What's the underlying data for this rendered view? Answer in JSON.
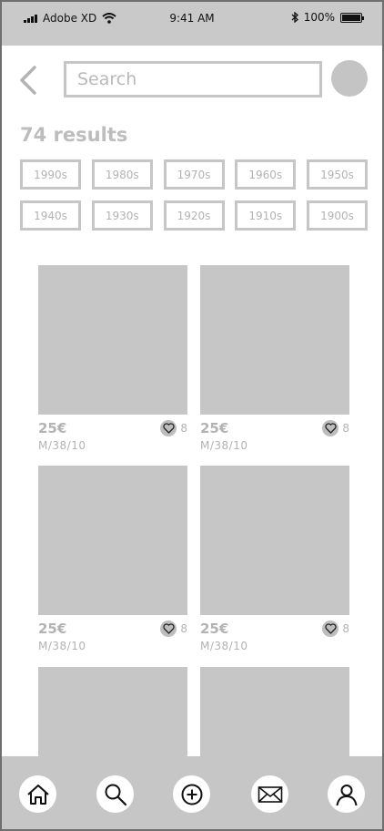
{
  "status_bar": {
    "carrier": "Adobe XD",
    "time": "9:41 AM",
    "battery": "100%",
    "battery_level": 1.0
  },
  "header": {
    "search_placeholder": "Search"
  },
  "results_label": "74 results",
  "filters": [
    "1990s",
    "1980s",
    "1970s",
    "1960s",
    "1950s",
    "1940s",
    "1930s",
    "1920s",
    "1910s",
    "1900s"
  ],
  "products": [
    {
      "price": "25€",
      "size": "M/38/10",
      "likes": "8"
    },
    {
      "price": "25€",
      "size": "M/38/10",
      "likes": "8"
    },
    {
      "price": "25€",
      "size": "M/38/10",
      "likes": "8"
    },
    {
      "price": "25€",
      "size": "M/38/10",
      "likes": "8"
    }
  ],
  "tab_bar": [
    "home-icon",
    "search-icon",
    "add-icon",
    "mail-icon",
    "profile-icon"
  ]
}
